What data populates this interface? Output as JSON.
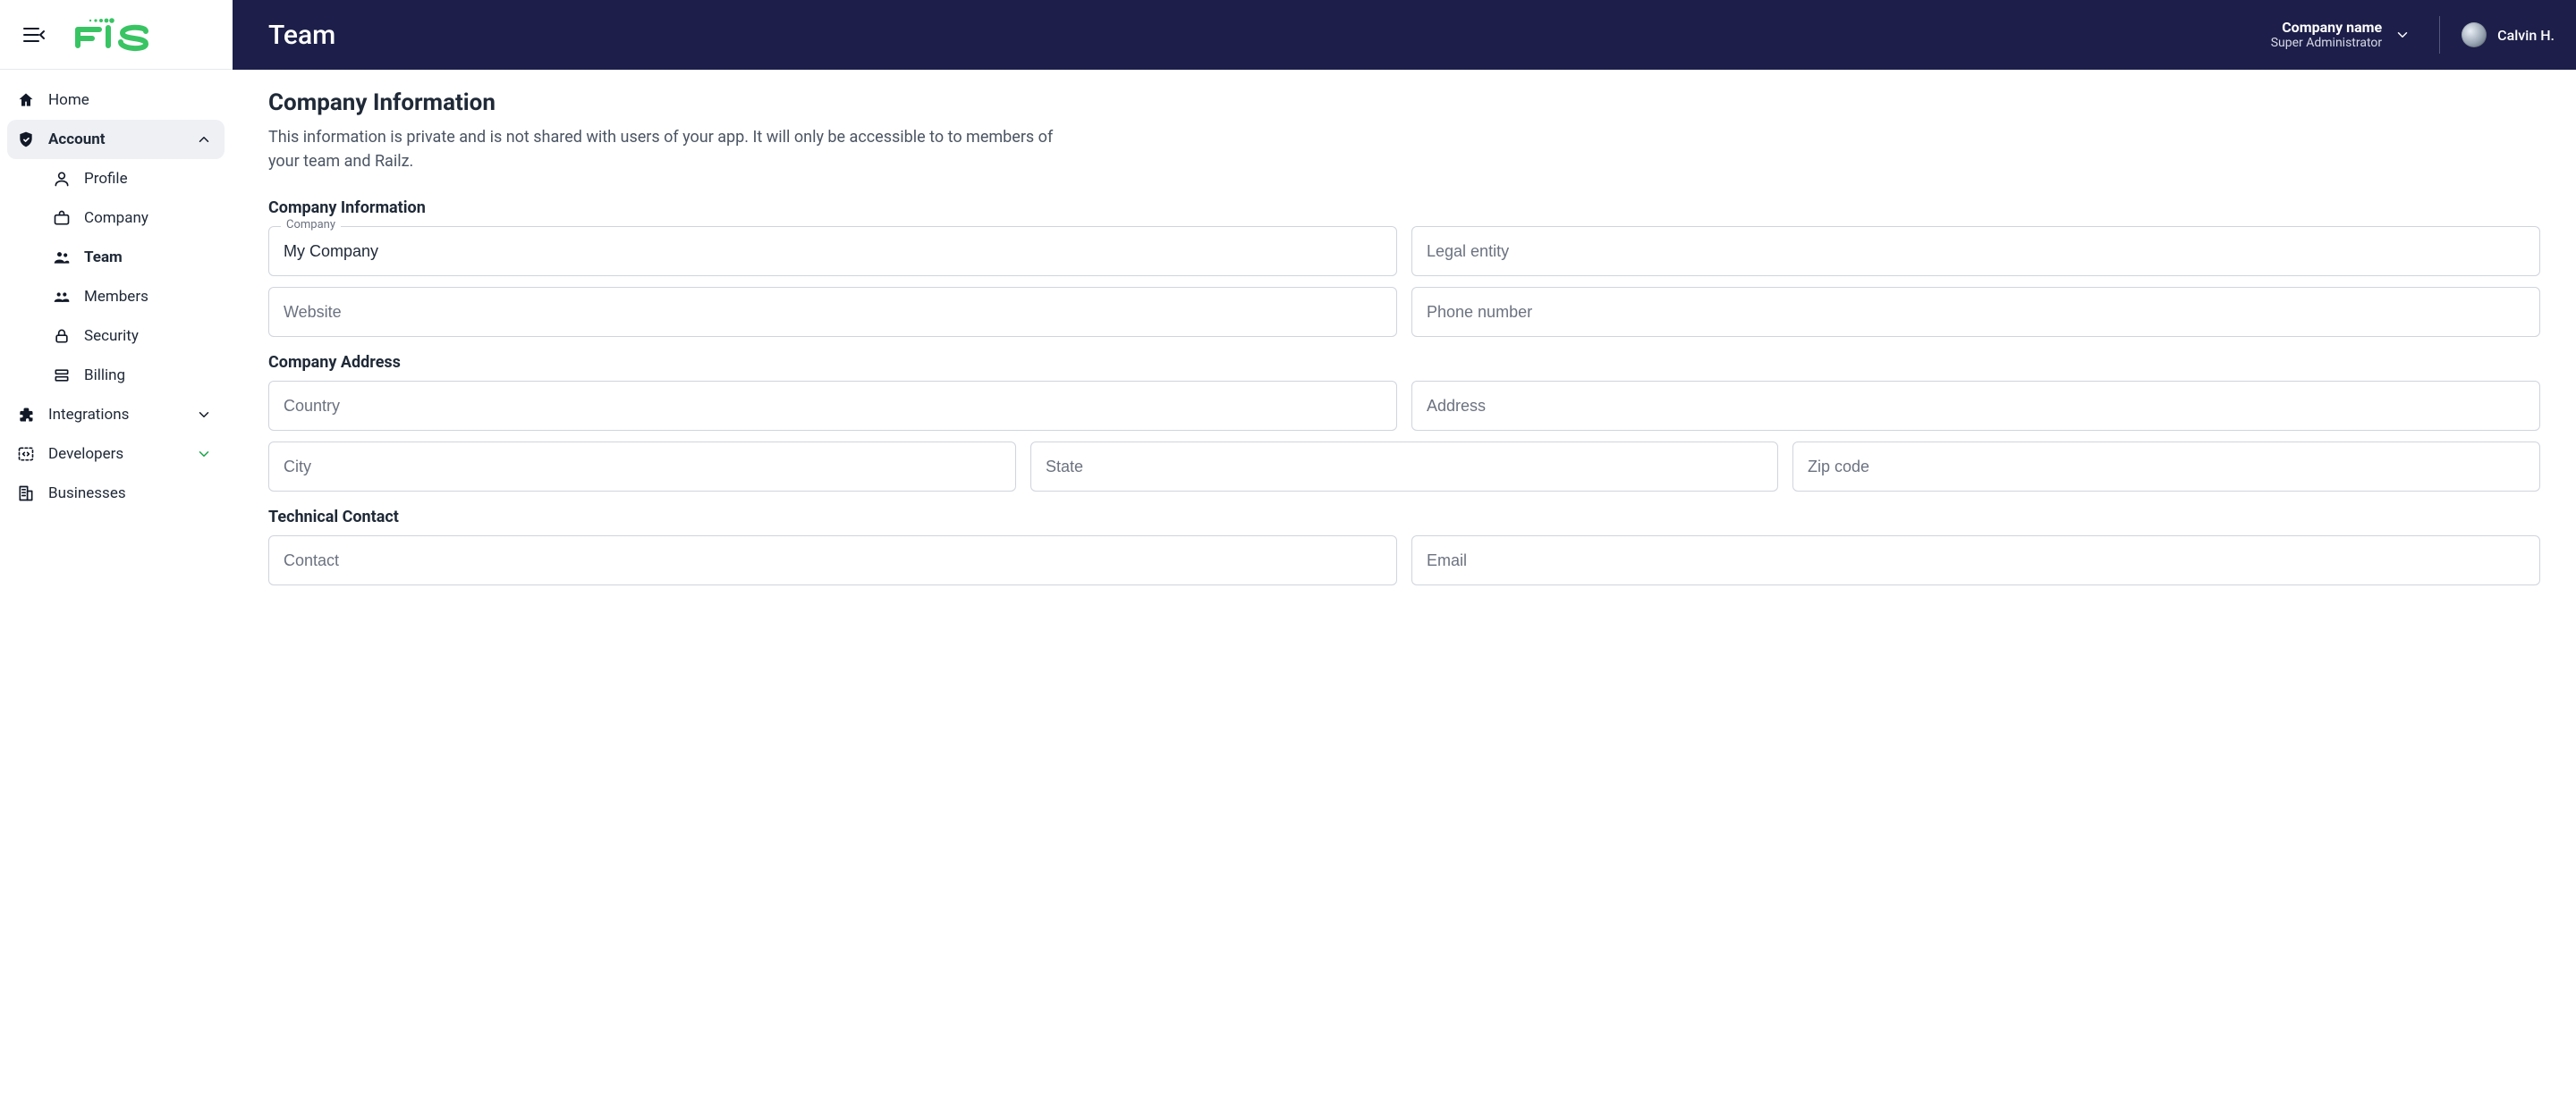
{
  "brand": {
    "name": "FIS",
    "accent": "#39c463"
  },
  "header": {
    "title": "Team",
    "company_name": "Company name",
    "company_role": "Super Administrator",
    "user_name": "Calvin H."
  },
  "sidebar": {
    "home": "Home",
    "account": "Account",
    "sub": {
      "profile": "Profile",
      "company": "Company",
      "team": "Team",
      "members": "Members",
      "security": "Security",
      "billing": "Billing"
    },
    "integrations": "Integrations",
    "developers": "Developers",
    "businesses": "Businesses"
  },
  "page": {
    "title": "Company Information",
    "description": "This information is private and is not shared with users of your app. It will only be accessible to to members of your team and Railz."
  },
  "sections": {
    "company_info_title": "Company Information",
    "company_address_title": "Company Address",
    "technical_contact_title": "Technical Contact"
  },
  "fields": {
    "company_label": "Company",
    "company_value": "My Company",
    "legal_entity_ph": "Legal entity",
    "website_ph": "Website",
    "phone_ph": "Phone number",
    "country_ph": "Country",
    "address_ph": "Address",
    "city_ph": "City",
    "state_ph": "State",
    "zip_ph": "Zip code",
    "contact_ph": "Contact",
    "email_ph": "Email"
  }
}
